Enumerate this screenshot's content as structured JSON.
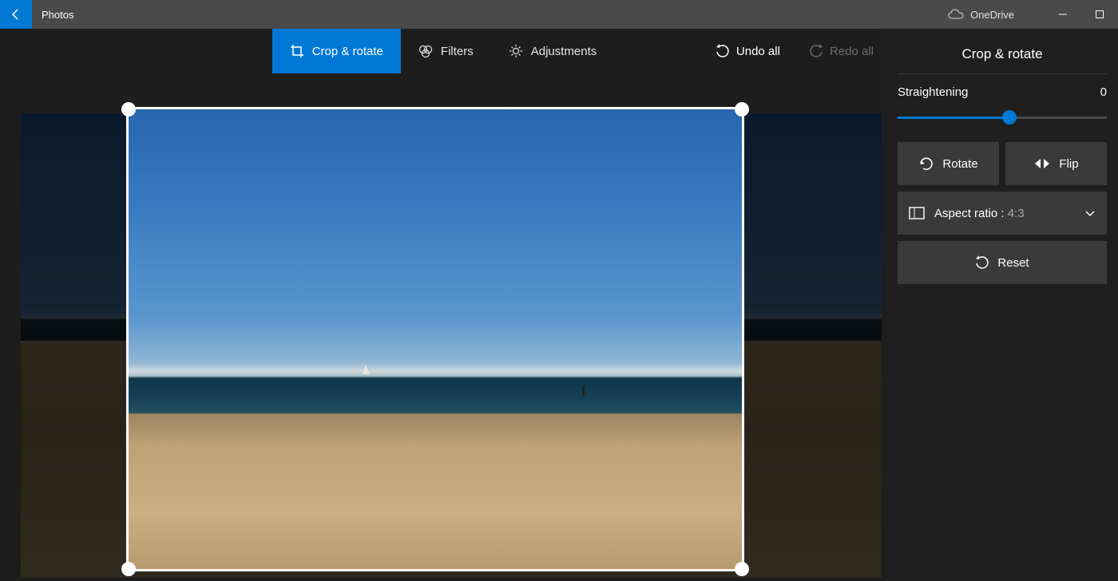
{
  "titlebar": {
    "app_name": "Photos",
    "onedrive_label": "OneDrive"
  },
  "toolbar": {
    "tabs": [
      {
        "label": "Crop & rotate"
      },
      {
        "label": "Filters"
      },
      {
        "label": "Adjustments"
      }
    ],
    "undo_label": "Undo all",
    "redo_label": "Redo all"
  },
  "panel": {
    "title": "Crop & rotate",
    "straighten_label": "Straightening",
    "straighten_value": "0",
    "rotate_label": "Rotate",
    "flip_label": "Flip",
    "aspect_label": "Aspect ratio :",
    "aspect_value": "4:3",
    "reset_label": "Reset"
  }
}
